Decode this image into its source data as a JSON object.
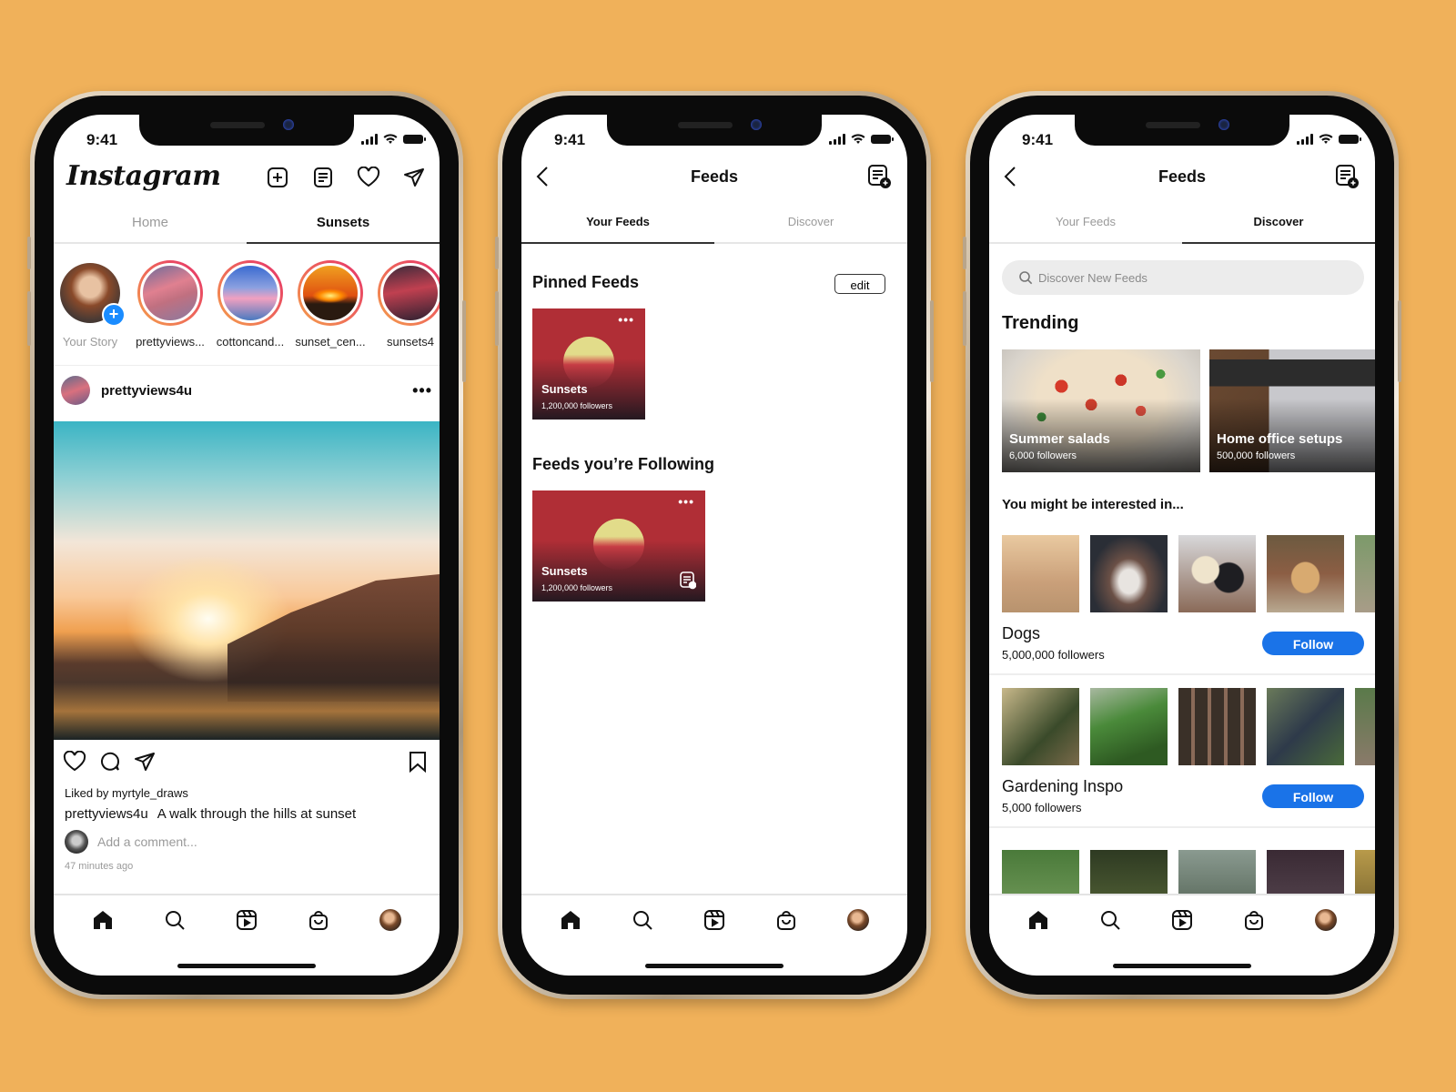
{
  "status_bar": {
    "time": "9:41"
  },
  "phone1": {
    "logo": "Instagram",
    "header_icons": [
      "new-post-icon",
      "feeds-icon",
      "heart-icon",
      "direct-message-icon"
    ],
    "tabs": [
      {
        "label": "Home",
        "active": false
      },
      {
        "label": "Sunsets",
        "active": true
      }
    ],
    "stories": [
      {
        "label": "Your Story",
        "own": true
      },
      {
        "label": "prettyviews..."
      },
      {
        "label": "cottoncand..."
      },
      {
        "label": "sunset_cen..."
      },
      {
        "label": "sunsets4"
      }
    ],
    "post": {
      "username": "prettyviews4u",
      "more": "•••",
      "liked_by_prefix": "Liked by ",
      "liked_by_user": "myrtyle_draws",
      "caption_user": "prettyviews4u",
      "caption_text": "A walk through the hills at sunset",
      "comment_placeholder": "Add a comment...",
      "time_ago": "47 minutes ago"
    }
  },
  "phone2": {
    "title": "Feeds",
    "tabs": [
      {
        "label": "Your Feeds",
        "active": true
      },
      {
        "label": "Discover",
        "active": false
      }
    ],
    "pinned_title": "Pinned Feeds",
    "edit_label": "edit",
    "pinned": [
      {
        "name": "Sunsets",
        "followers": "1,200,000 followers",
        "more": "•••"
      }
    ],
    "following_title": "Feeds you’re Following",
    "following": [
      {
        "name": "Sunsets",
        "followers": "1,200,000 followers",
        "more": "•••"
      }
    ]
  },
  "phone3": {
    "title": "Feeds",
    "tabs": [
      {
        "label": "Your Feeds",
        "active": false
      },
      {
        "label": "Discover",
        "active": true
      }
    ],
    "search_placeholder": "Discover New Feeds",
    "trending_title": "Trending",
    "trending": [
      {
        "name": "Summer salads",
        "followers": "6,000 followers"
      },
      {
        "name": "Home office setups",
        "followers": "500,000 followers"
      }
    ],
    "interested_title": "You might be interested in...",
    "recommendations": [
      {
        "name": "Dogs",
        "followers": "5,000,000 followers",
        "follow_label": "Follow"
      },
      {
        "name": "Gardening Inspo",
        "followers": "5,000 followers",
        "follow_label": "Follow"
      }
    ]
  },
  "tabbar": [
    "home-icon",
    "search-icon",
    "reels-icon",
    "shop-icon",
    "profile-avatar"
  ],
  "colors": {
    "background": "#f0b15a",
    "follow_button": "#1a73e8",
    "story_ring_start": "#f5a04a",
    "story_ring_end": "#e6306a"
  }
}
